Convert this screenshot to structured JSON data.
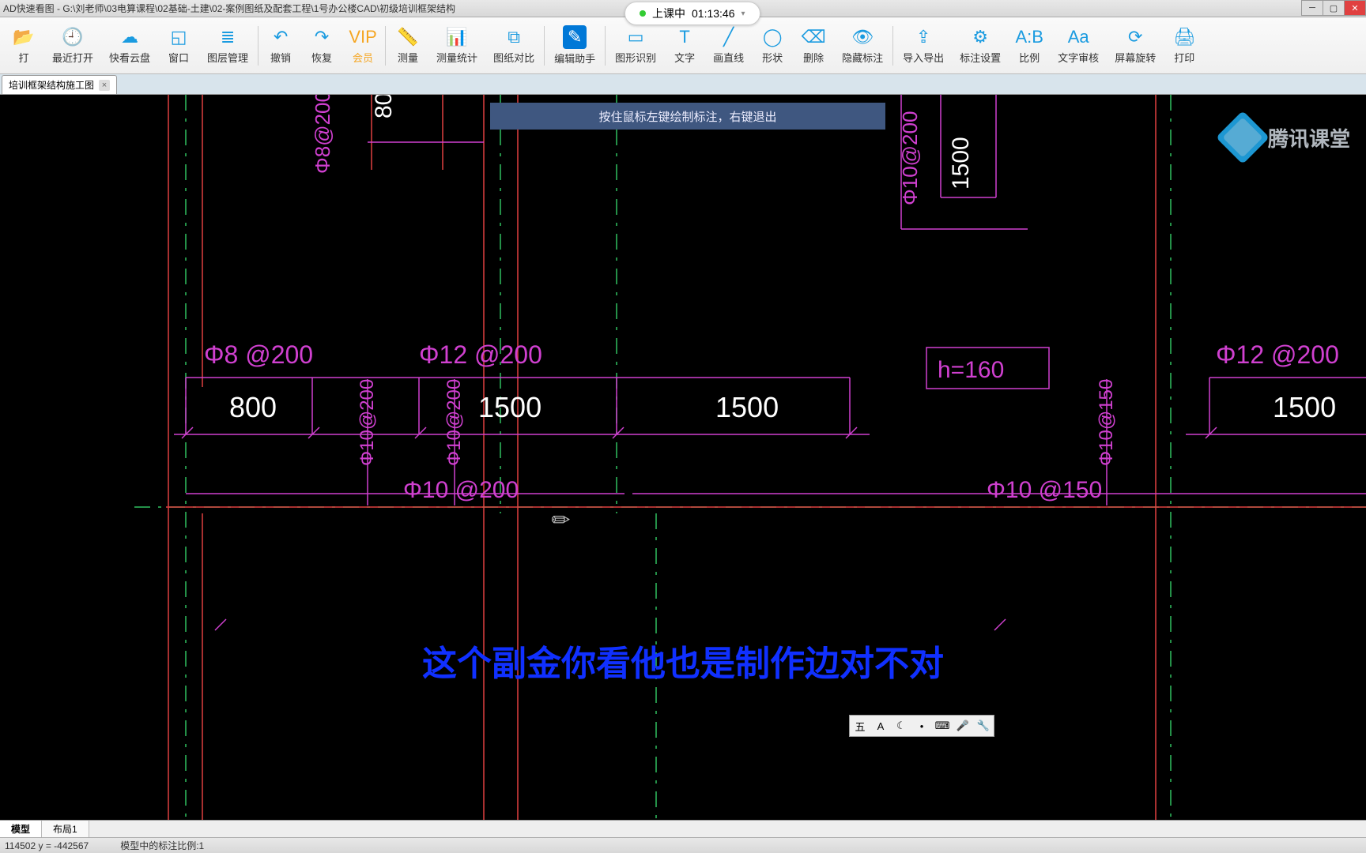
{
  "title": "AD快速看图 - G:\\刘老师\\03电算课程\\02基础-土建\\02-案例图纸及配套工程\\1号办公楼CAD\\初级培训框架结构",
  "timer": {
    "label": "上课中",
    "time": "01:13:46"
  },
  "toolbar": [
    {
      "id": "open",
      "label": "打",
      "icon": "📂"
    },
    {
      "id": "recent",
      "label": "最近打开",
      "icon": "🕘"
    },
    {
      "id": "cloud",
      "label": "快看云盘",
      "icon": "☁"
    },
    {
      "id": "window",
      "label": "窗口",
      "icon": "◱"
    },
    {
      "id": "layer",
      "label": "图层管理",
      "icon": "≣"
    },
    {
      "id": "undo",
      "label": "撤销",
      "icon": "↶"
    },
    {
      "id": "redo",
      "label": "恢复",
      "icon": "↷"
    },
    {
      "id": "vip",
      "label": "会员",
      "icon": "VIP"
    },
    {
      "id": "measure",
      "label": "测量",
      "icon": "📏"
    },
    {
      "id": "stats",
      "label": "测量统计",
      "icon": "📊"
    },
    {
      "id": "compare",
      "label": "图纸对比",
      "icon": "⧉"
    },
    {
      "id": "edit",
      "label": "编辑助手",
      "icon": "✎"
    },
    {
      "id": "recognize",
      "label": "图形识别",
      "icon": "▭"
    },
    {
      "id": "text",
      "label": "文字",
      "icon": "T"
    },
    {
      "id": "line",
      "label": "画直线",
      "icon": "╱"
    },
    {
      "id": "shape",
      "label": "形状",
      "icon": "◯"
    },
    {
      "id": "delete",
      "label": "删除",
      "icon": "⌫"
    },
    {
      "id": "hide",
      "label": "隐藏标注",
      "icon": "👁"
    },
    {
      "id": "io",
      "label": "导入导出",
      "icon": "⇪"
    },
    {
      "id": "dimset",
      "label": "标注设置",
      "icon": "⚙"
    },
    {
      "id": "scale",
      "label": "比例",
      "icon": "A:B"
    },
    {
      "id": "textrev",
      "label": "文字审核",
      "icon": "Aa"
    },
    {
      "id": "screen",
      "label": "屏幕旋转",
      "icon": "⟳"
    },
    {
      "id": "print",
      "label": "打印",
      "icon": "🖨"
    }
  ],
  "tab": {
    "name": "培训框架结构施工图"
  },
  "hint": "按住鼠标左键绘制标注，右键退出",
  "subtitle": "这个副金你看他也是制作边对不对",
  "watermark": "腾讯课堂",
  "cad_labels": {
    "d800": "800",
    "d1500a": "1500",
    "d1500b": "1500",
    "d1500c": "1500",
    "d1500v": "1500",
    "d80": "80",
    "p8_200a": "Φ8 @200",
    "p8_200b": "Φ8@200",
    "p12_200a": "Φ12 @200",
    "p12_200b": "Φ12 @200",
    "p10_200a": "Φ10@200",
    "p10_200b": "Φ10@200",
    "p10_200c": "Φ10 @200",
    "p10_200d": "Φ10@200",
    "p10_150a": "Φ10@150",
    "p10_150b": "Φ10 @150",
    "h160": "h=160"
  },
  "bottom_tabs": {
    "model": "模型",
    "layout1": "布局1"
  },
  "status": {
    "coords": "114502  y = -442567",
    "info": "模型中的标注比例:1"
  }
}
